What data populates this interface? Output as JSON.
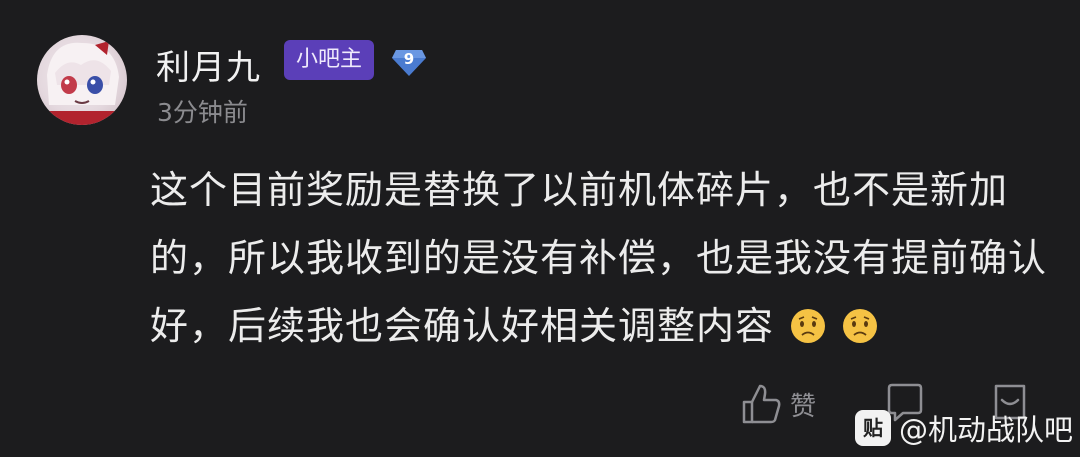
{
  "post": {
    "author": {
      "name": "利月九",
      "role_badge": "小吧主",
      "level": "9",
      "avatar_icon": "anime-avatar-icon"
    },
    "timestamp": "3分钟前",
    "content": {
      "text": "这个目前奖励是替换了以前机体碎片，也不是新加的，所以我收到的是没有补偿，也是我没有提前确认好，后续我也会确认好相关调整内容",
      "emojis": [
        "worried-face-emoji",
        "worried-face-emoji"
      ]
    },
    "actions": {
      "like_label": "赞",
      "like_icon": "thumbs-up-icon",
      "comment_icon": "comment-icon",
      "share_icon": "share-icon"
    }
  },
  "watermark": {
    "logo_text": "贴",
    "text": "@机动战队吧"
  },
  "colors": {
    "background": "#1c1c1e",
    "role_badge": "#5b3fb8",
    "level_badge": "#4a7bd0",
    "muted_text": "#8b8b8f"
  }
}
